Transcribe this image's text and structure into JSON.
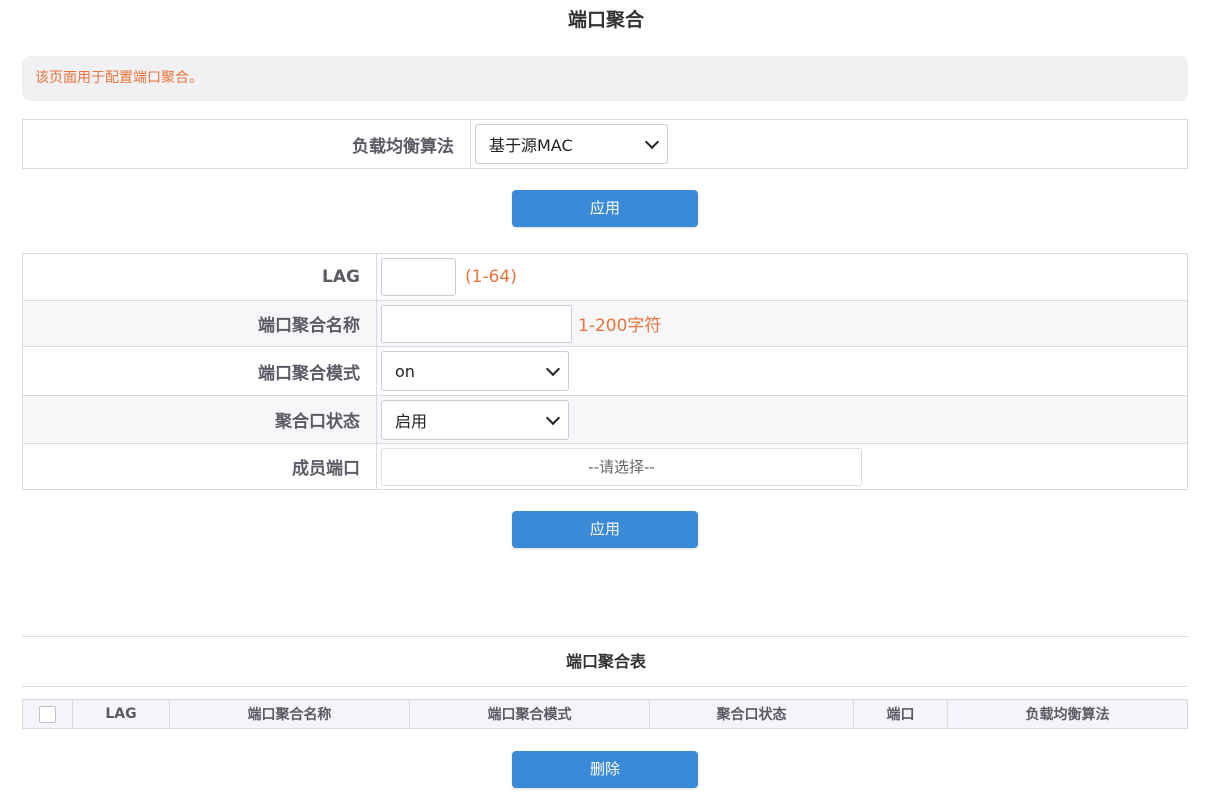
{
  "page": {
    "title": "端口聚合",
    "notice": "该页面用于配置端口聚合。"
  },
  "load_balance": {
    "label": "负载均衡算法",
    "selected": "基于源MAC",
    "apply_label": "应用"
  },
  "lag_form": {
    "lag_label": "LAG",
    "lag_value": "",
    "lag_hint": "(1-64)",
    "name_label": "端口聚合名称",
    "name_value": "",
    "name_hint": "1-200字符",
    "mode_label": "端口聚合模式",
    "mode_selected": "on",
    "status_label": "聚合口状态",
    "status_selected": "启用",
    "members_label": "成员端口",
    "members_placeholder": "--请选择--",
    "apply_label": "应用"
  },
  "lag_table": {
    "title": "端口聚合表",
    "columns": [
      "LAG",
      "端口聚合名称",
      "端口聚合模式",
      "聚合口状态",
      "端口",
      "负载均衡算法"
    ],
    "delete_label": "删除"
  },
  "colors": {
    "accent": "#3b8ad8",
    "hint": "#e8743b",
    "notice_bg": "#f1f1f3",
    "border": "#d8dbe6"
  }
}
